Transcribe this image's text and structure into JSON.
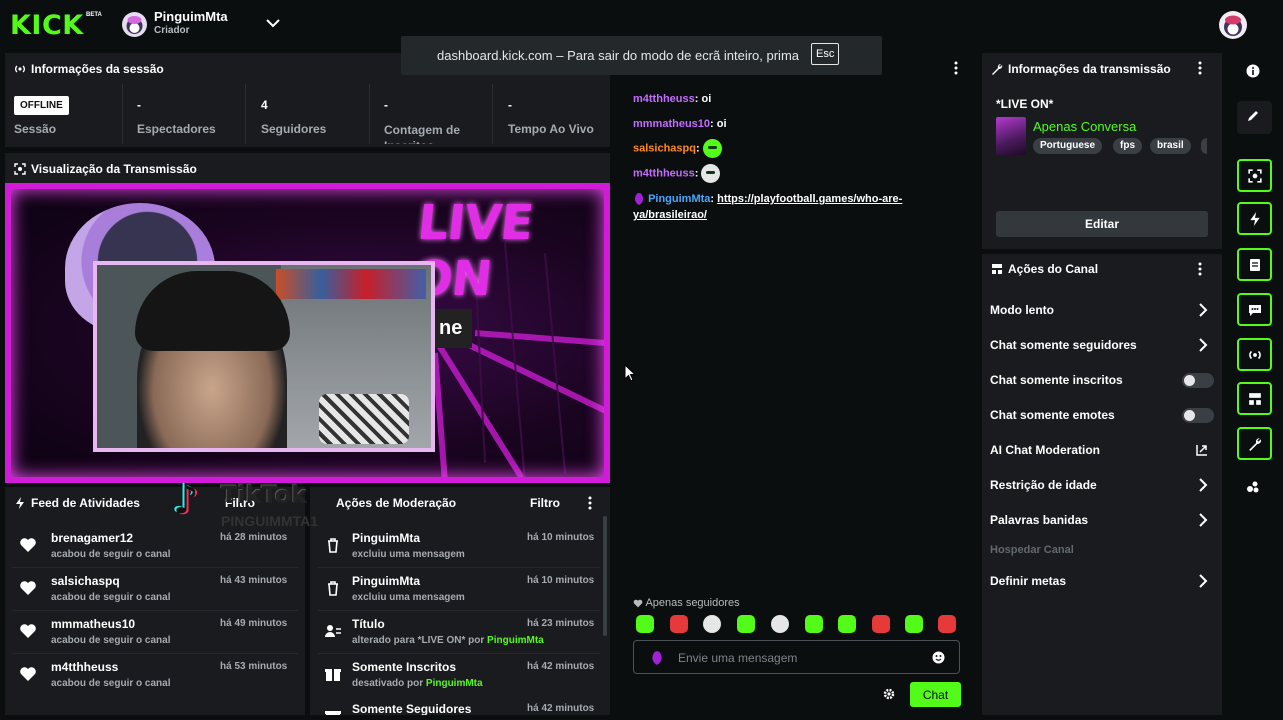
{
  "topbar": {
    "logo": "KICK",
    "logo_badge": "BETA",
    "channel_name": "PinguimMta",
    "channel_role": "Criador"
  },
  "fullscreen_toast": {
    "message": "dashboard.kick.com – Para sair do modo de ecrã inteiro, prima",
    "key": "Esc"
  },
  "session": {
    "title": "Informações da sessão",
    "status_badge": "OFFLINE",
    "stats": [
      {
        "value": "",
        "label": "Sessão"
      },
      {
        "value": "-",
        "label": "Espectadores"
      },
      {
        "value": "4",
        "label": "Seguidores"
      },
      {
        "value": "-",
        "label": "Contagem de Inscritos"
      },
      {
        "value": "-",
        "label": "Tempo Ao Vivo"
      }
    ]
  },
  "preview": {
    "title": "Visualização da Transmissão",
    "overlay_text": "LIVE ON",
    "overlay_subtext": "ne",
    "watermark_word": "TikTok",
    "watermark_handle": "PINGUIMMTA1"
  },
  "activity_feed": {
    "title": "Feed de Atividades",
    "filter": "Filtro",
    "items": [
      {
        "name": "brenagamer12",
        "sub": "acabou de seguir o canal",
        "time": "há 28 minutos"
      },
      {
        "name": "salsichaspq",
        "sub": "acabou de seguir o canal",
        "time": "há 43 minutos"
      },
      {
        "name": "mmmatheus10",
        "sub": "acabou de seguir o canal",
        "time": "há 49 minutos"
      },
      {
        "name": "m4tthheuss",
        "sub": "acabou de seguir o canal",
        "time": "há 53 minutos"
      }
    ]
  },
  "moderation": {
    "title": "Ações de Moderação",
    "filter": "Filtro",
    "items": [
      {
        "name": "PinguimMta",
        "sub": "excluiu uma mensagem",
        "sub_highlight": "",
        "time": "há 10 minutos"
      },
      {
        "name": "PinguimMta",
        "sub": "excluiu uma mensagem",
        "sub_highlight": "",
        "time": "há 10 minutos"
      },
      {
        "name": "Título",
        "sub": "alterado para *LIVE ON* por ",
        "sub_highlight": "PinguimMta",
        "time": "há 23 minutos"
      },
      {
        "name": "Somente Inscritos",
        "sub": "desativado por ",
        "sub_highlight": "PinguimMta",
        "time": "há 42 minutos"
      },
      {
        "name": "Somente Seguidores",
        "sub": "",
        "sub_highlight": "",
        "time": "há 42 minutos"
      }
    ]
  },
  "chat": {
    "messages": [
      {
        "user": "m4tthheuss",
        "text": "oi",
        "color": "#c46bff"
      },
      {
        "user": "mmmatheus10",
        "text": "oi",
        "color": "#c46bff"
      },
      {
        "user": "salsichaspq",
        "text": "",
        "color": "#ff8a1e"
      },
      {
        "user": "m4tthheuss",
        "text": "",
        "color": "#c46bff"
      },
      {
        "user": "PinguimMta",
        "text": "https://playfootball.games/who-are-ya/brasileirao/",
        "text_line1": "https://playfootball.games/who-are-",
        "text_line2": "ya/brasileirao/",
        "color": "#46a8ff"
      }
    ],
    "mode_notice": "Apenas seguidores",
    "input_placeholder": "Envie uma mensagem",
    "send_label": "Chat"
  },
  "stream_info": {
    "title": "Informações da transmissão",
    "stream_title": "*LIVE ON*",
    "category": "Apenas Conversa",
    "tags": [
      "Portuguese",
      "fps",
      "brasil"
    ],
    "edit_label": "Editar"
  },
  "channel_actions": {
    "title": "Ações do Canal",
    "items": [
      {
        "label": "Modo lento",
        "control": "chevron"
      },
      {
        "label": "Chat somente seguidores",
        "control": "chevron"
      },
      {
        "label": "Chat somente inscritos",
        "control": "toggle"
      },
      {
        "label": "Chat somente emotes",
        "control": "toggle"
      },
      {
        "label": "AI Chat Moderation",
        "control": "external"
      },
      {
        "label": "Restrição de idade",
        "control": "chevron"
      },
      {
        "label": "Palavras banidas",
        "control": "chevron"
      },
      {
        "label": "Hospedar Canal",
        "control": "disabled"
      },
      {
        "label": "Definir metas",
        "control": "chevron"
      }
    ]
  },
  "right_rail": {
    "icons": [
      "info-icon",
      "pencil-icon",
      "screen-capture-icon",
      "lightning-icon",
      "notes-icon",
      "chat-bubble-icon",
      "broadcast-icon",
      "layout-icon",
      "wrench-icon",
      "circles-icon"
    ]
  },
  "colors": {
    "brand": "#53fc18",
    "panel": "#191b1f",
    "background": "#0b0e0f"
  }
}
